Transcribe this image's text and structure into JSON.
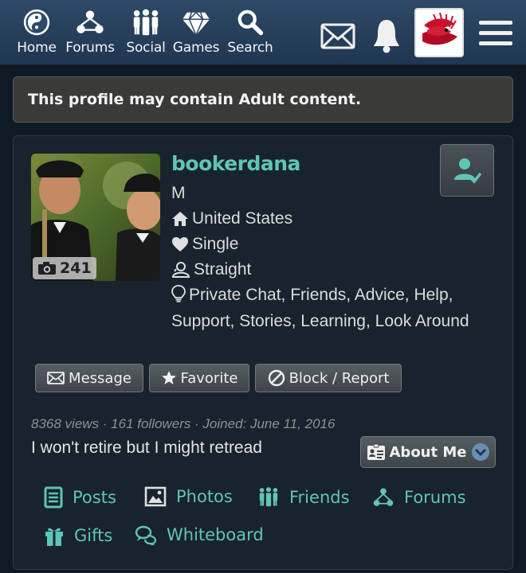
{
  "nav": {
    "home": "Home",
    "forums": "Forums",
    "social": "Social",
    "games": "Games",
    "search": "Search"
  },
  "banner": {
    "text": "This profile may contain Adult content."
  },
  "profile": {
    "username": "bookerdana",
    "gender": "M",
    "location": "United States",
    "relationship": "Single",
    "orientation": "Straight",
    "seeking": "Private Chat, Friends, Advice, Help, Support, Stories, Learning, Look Around",
    "photo_count": "241",
    "stats": "8368 views · 161 followers · Joined: June 11, 2016",
    "tagline": "I won't retire but I might retread"
  },
  "actions": {
    "message": "Message",
    "favorite": "Favorite",
    "block": "Block / Report",
    "about": "About Me"
  },
  "tabs": {
    "posts": "Posts",
    "photos": "Photos",
    "friends": "Friends",
    "forums": "Forums",
    "gifts": "Gifts",
    "whiteboard": "Whiteboard"
  },
  "colors": {
    "accent": "#5ec6b5",
    "topbar": "#2e4a66",
    "card": "#18232d"
  }
}
